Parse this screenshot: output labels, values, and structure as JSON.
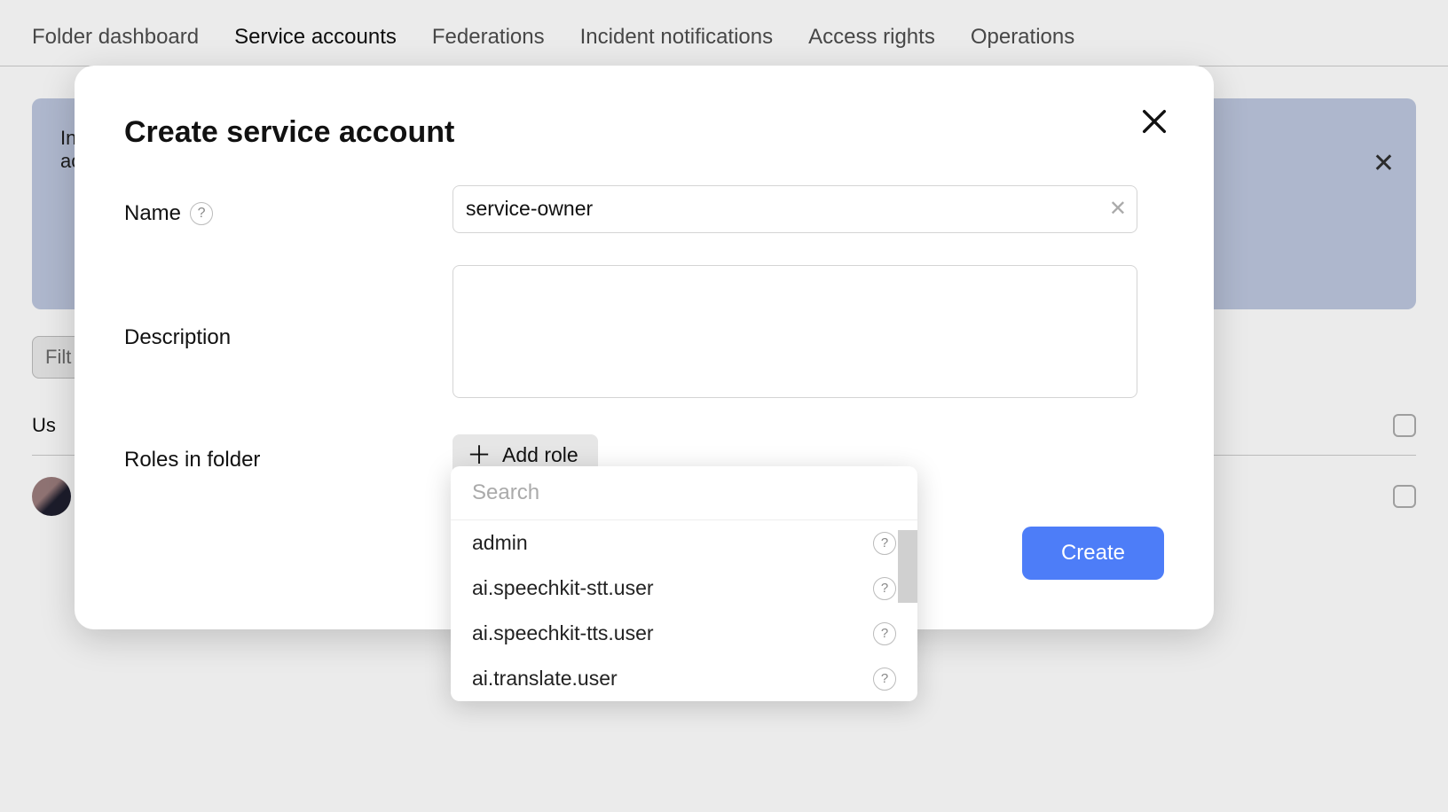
{
  "tabs": {
    "dashboard": "Folder dashboard",
    "service_accounts": "Service accounts",
    "federations": "Federations",
    "incident": "Incident notifications",
    "access": "Access rights",
    "operations": "Operations"
  },
  "banner": {
    "text_line1": "In",
    "text_line2": "ac"
  },
  "filter": {
    "placeholder": "Filt"
  },
  "table": {
    "col_user": "Us"
  },
  "modal": {
    "title": "Create service account",
    "name_label": "Name",
    "name_value": "service-owner",
    "desc_label": "Description",
    "desc_value": "",
    "roles_label": "Roles in folder",
    "add_role_label": "Add role",
    "create_label": "Create"
  },
  "dropdown": {
    "search_placeholder": "Search",
    "items": [
      "admin",
      "ai.speechkit-stt.user",
      "ai.speechkit-tts.user",
      "ai.translate.user"
    ]
  }
}
